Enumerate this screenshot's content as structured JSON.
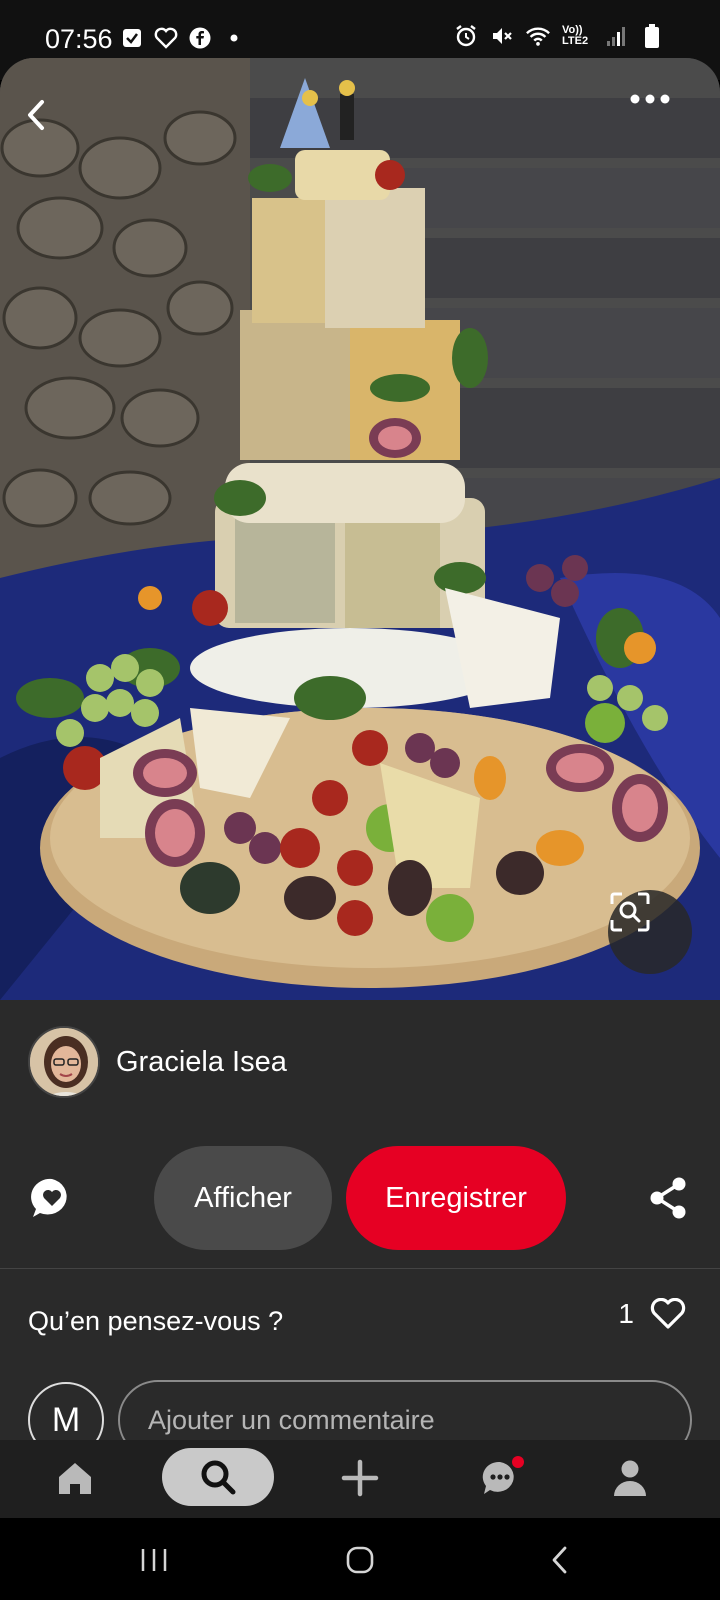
{
  "status_bar": {
    "time": "07:56",
    "network_label": "Vo)) LTE2",
    "icons_left": [
      "checkbox-icon",
      "heart-outline-icon",
      "facebook-icon",
      "dot-icon"
    ],
    "icons_right": [
      "alarm-icon",
      "mute-icon",
      "wifi-icon",
      "signal-icon",
      "battery-icon"
    ]
  },
  "pin": {
    "image_subject": "cheese-wheel-cake",
    "author": {
      "name": "Graciela Isea"
    },
    "actions": {
      "view_label": "Afficher",
      "save_label": "Enregistrer"
    },
    "comments": {
      "question": "Qu’en pensez-vous ?",
      "like_count": "1",
      "user_initial": "M",
      "input_placeholder": "Ajouter un commentaire"
    }
  },
  "bottom_nav": {
    "items": [
      "home-icon",
      "search-icon",
      "plus-icon",
      "messages-icon",
      "profile-icon"
    ],
    "active": "search-icon",
    "messages_has_notification": true
  },
  "system_nav": [
    "recents-icon",
    "home-circle-icon",
    "back-chevron-icon"
  ],
  "colors": {
    "accent_red": "#e60023",
    "panel_bg": "#2a2a2a",
    "nav_bg": "#1f1f1f"
  }
}
